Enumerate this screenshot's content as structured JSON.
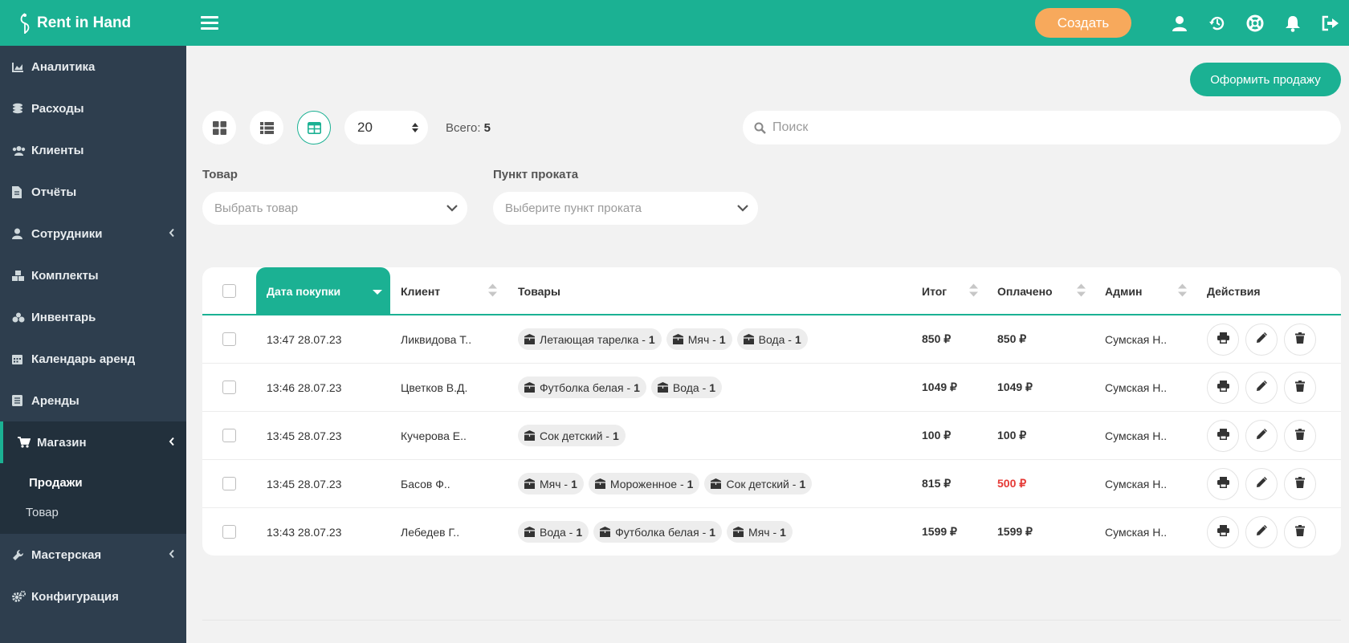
{
  "app": {
    "brand": "Rent in Hand"
  },
  "topbar": {
    "create_label": "Создать",
    "icons": [
      "user-icon",
      "history-icon",
      "support-icon",
      "bell-icon",
      "logout-icon"
    ]
  },
  "sidebar": {
    "items": [
      {
        "label": "Аналитика",
        "icon": "chart-icon"
      },
      {
        "label": "Расходы",
        "icon": "coins-icon"
      },
      {
        "label": "Клиенты",
        "icon": "users-icon"
      },
      {
        "label": "Отчёты",
        "icon": "report-icon"
      },
      {
        "label": "Сотрудники",
        "icon": "staff-icon",
        "expandable": true
      },
      {
        "label": "Комплекты",
        "icon": "kits-icon"
      },
      {
        "label": "Инвентарь",
        "icon": "inventory-icon"
      },
      {
        "label": "Календарь аренд",
        "icon": "calendar-icon"
      },
      {
        "label": "Аренды",
        "icon": "rentals-icon"
      },
      {
        "label": "Магазин",
        "icon": "cart-icon",
        "active": true,
        "expanded": true
      },
      {
        "label": "Мастерская",
        "icon": "wrench-icon",
        "expandable": true
      },
      {
        "label": "Конфигурация",
        "icon": "cogs-icon"
      }
    ],
    "shop_sub": [
      "Продажи",
      "Товар"
    ]
  },
  "main": {
    "sale_button": "Оформить продажу",
    "per_page": "20",
    "total_label": "Всего:",
    "total_value": "5",
    "search_placeholder": "Поиск",
    "filters": {
      "product_label": "Товар",
      "product_placeholder": "Выбрать товар",
      "point_label": "Пункт проката",
      "point_placeholder": "Выберите пункт проката"
    }
  },
  "table": {
    "headers": {
      "date": "Дата покупки",
      "client": "Клиент",
      "goods": "Товары",
      "total": "Итог",
      "paid": "Оплачено",
      "admin": "Админ",
      "actions": "Действия"
    },
    "rows": [
      {
        "date": "13:47 28.07.23",
        "client": "Ликвидова Т..",
        "items": [
          [
            "Летающая тарелка -",
            "1"
          ],
          [
            "Мяч -",
            "1"
          ],
          [
            "Вода -",
            "1"
          ]
        ],
        "total": "850 ₽",
        "paid": "850 ₽",
        "paid_status": "full",
        "admin": "Сумская Н.."
      },
      {
        "date": "13:46 28.07.23",
        "client": "Цветков В.Д.",
        "items": [
          [
            "Футболка белая -",
            "1"
          ],
          [
            "Вода -",
            "1"
          ]
        ],
        "total": "1049 ₽",
        "paid": "1049 ₽",
        "paid_status": "full",
        "admin": "Сумская Н.."
      },
      {
        "date": "13:45 28.07.23",
        "client": "Кучерова Е..",
        "items": [
          [
            "Сок детский -",
            "1"
          ]
        ],
        "total": "100 ₽",
        "paid": "100 ₽",
        "paid_status": "full",
        "admin": "Сумская Н.."
      },
      {
        "date": "13:45 28.07.23",
        "client": "Басов Ф..",
        "items": [
          [
            "Мяч -",
            "1"
          ],
          [
            "Мороженное -",
            "1"
          ],
          [
            "Сок детский -",
            "1"
          ]
        ],
        "total": "815 ₽",
        "paid": "500 ₽",
        "paid_status": "partial",
        "admin": "Сумская Н.."
      },
      {
        "date": "13:43 28.07.23",
        "client": "Лебедев Г..",
        "items": [
          [
            "Вода -",
            "1"
          ],
          [
            "Футболка белая -",
            "1"
          ],
          [
            "Мяч -",
            "1"
          ]
        ],
        "total": "1599 ₽",
        "paid": "1599 ₽",
        "paid_status": "full",
        "admin": "Сумская Н.."
      }
    ]
  },
  "colors": {
    "brand": "#1bb193",
    "accent": "#f7a95c",
    "sidebar": "#2e3e4e",
    "debt": "#e53935"
  }
}
